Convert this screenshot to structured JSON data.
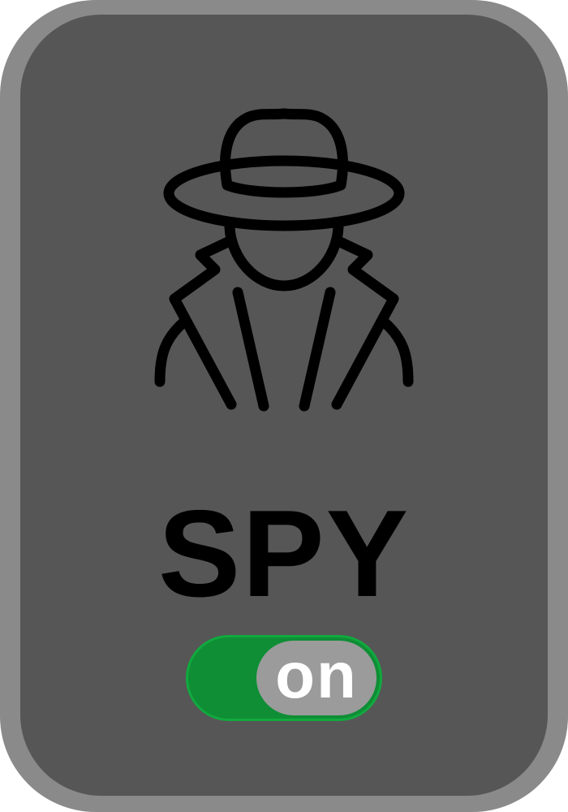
{
  "card": {
    "title": "SPY",
    "icon": "spy-icon",
    "border_color": "#8a8a8a",
    "face_color": "#565656"
  },
  "toggle": {
    "state_label": "on",
    "on": true,
    "track_color": "#0f8e35",
    "knob_color": "#9b9b9b"
  }
}
